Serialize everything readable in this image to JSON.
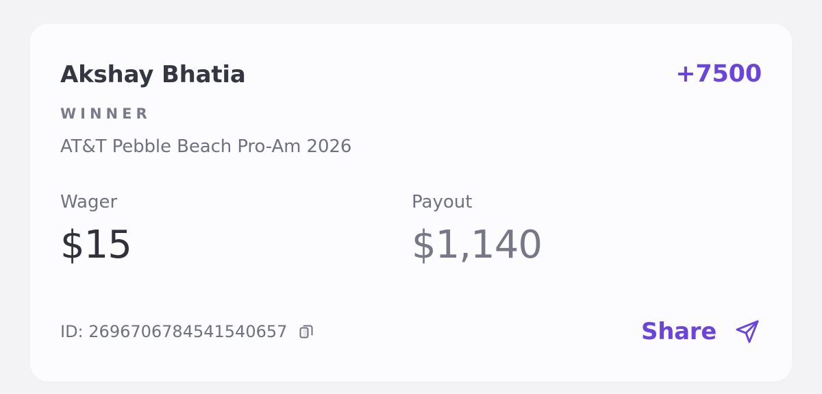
{
  "bet_card": {
    "player_name": "Akshay Bhatia",
    "odds": "+7500",
    "market_label": "WINNER",
    "event_name": "AT&T Pebble Beach Pro-Am 2026",
    "wager": {
      "label": "Wager",
      "value": "$15"
    },
    "payout": {
      "label": "Payout",
      "value": "$1,140"
    },
    "bet_id_text": "ID: 2696706784541540657",
    "share_label": "Share",
    "icons": {
      "copy": "copy-icon",
      "share": "send-icon"
    },
    "colors": {
      "accent": "#6a45d8",
      "primary_text": "#343641",
      "secondary_text": "#6f7080",
      "payout_text": "#767888",
      "card_background": "#fcfbfe",
      "page_background": "#f3f3f5"
    }
  }
}
